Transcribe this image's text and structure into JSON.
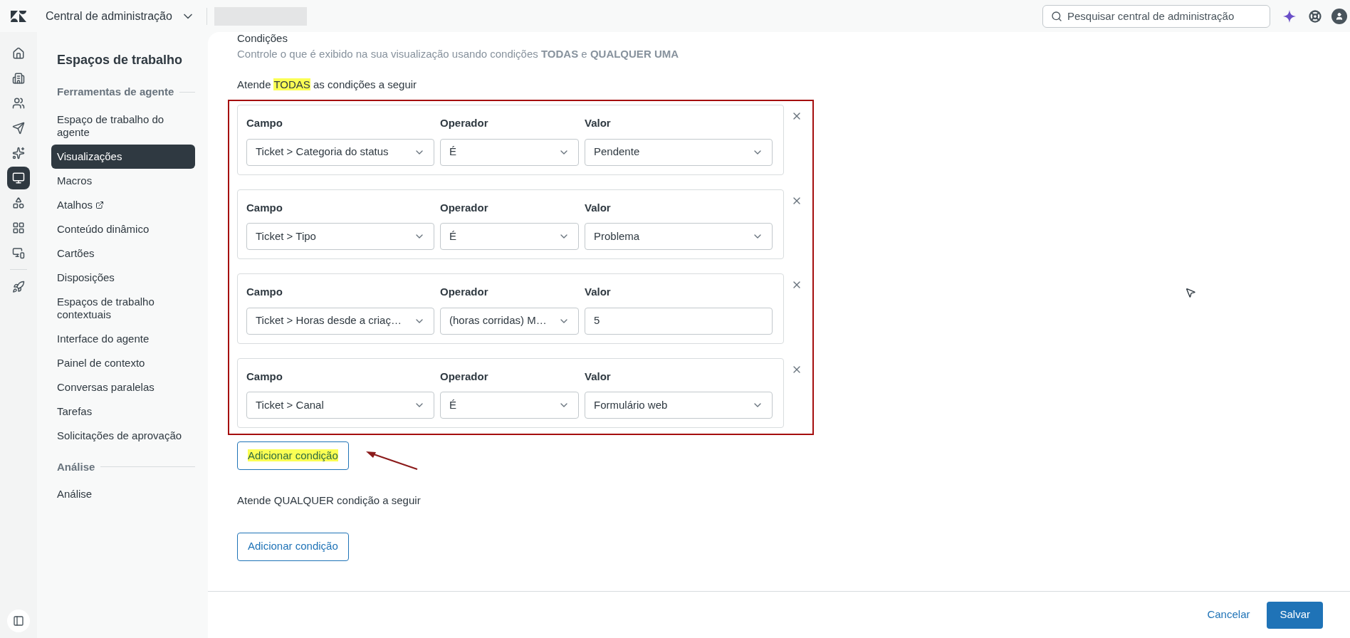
{
  "top_bar": {
    "title": "Central de administração",
    "search": {
      "placeholder": "Pesquisar central de administração"
    }
  },
  "rail": [
    {
      "selected": false
    },
    {
      "selected": false
    },
    {
      "selected": false
    },
    {
      "selected": false
    },
    {
      "selected": false
    },
    {
      "selected": true
    },
    {
      "selected": false
    },
    {
      "selected": false
    },
    {
      "selected": false
    },
    {
      "selected": false
    }
  ],
  "sidebar": {
    "title": "Espaços de trabalho",
    "sections": [
      {
        "heading": "Ferramentas de agente",
        "items": [
          {
            "label": "Espaço de trabalho do agente",
            "selected": false,
            "external": false
          },
          {
            "label": "Visualizações",
            "selected": true,
            "external": false
          },
          {
            "label": "Macros",
            "selected": false,
            "external": false
          },
          {
            "label": "Atalhos",
            "selected": false,
            "external": true
          },
          {
            "label": "Conteúdo dinâmico",
            "selected": false,
            "external": false
          },
          {
            "label": "Cartões",
            "selected": false,
            "external": false
          },
          {
            "label": "Disposições",
            "selected": false,
            "external": false
          },
          {
            "label": "Espaços de trabalho contextuais",
            "selected": false,
            "external": false
          },
          {
            "label": "Interface do agente",
            "selected": false,
            "external": false
          },
          {
            "label": "Painel de contexto",
            "selected": false,
            "external": false
          },
          {
            "label": "Conversas paralelas",
            "selected": false,
            "external": false
          },
          {
            "label": "Tarefas",
            "selected": false,
            "external": false
          },
          {
            "label": "Solicitações de aprovação",
            "selected": false,
            "external": false
          }
        ]
      },
      {
        "heading": "Análise",
        "items": [
          {
            "label": "Análise",
            "selected": false,
            "external": false
          }
        ]
      }
    ]
  },
  "conditions": {
    "heading": "Condições",
    "subtitle": "Controle o que é exibido na sua visualização usando condições **TODAS** e **QUALQUER UMA**",
    "all": {
      "label_before": "Atende ",
      "label_highlight": "TODAS",
      "label_after": " as condições a seguir",
      "rows": [
        {
          "field_label": "Campo",
          "operator_label": "Operador",
          "value_label": "Valor",
          "field": "Ticket > Categoria do status",
          "operator": "É",
          "value": "Pendente",
          "kind": "select"
        },
        {
          "field_label": "Campo",
          "operator_label": "Operador",
          "value_label": "Valor",
          "field": "Ticket > Tipo",
          "operator": "É",
          "value": "Problema",
          "kind": "select"
        },
        {
          "field_label": "Campo",
          "operator_label": "Operador",
          "value_label": "Valor",
          "field": "Ticket > Horas desde a criaç…",
          "operator": "(horas corridas) M…",
          "value": "5",
          "kind": "text"
        },
        {
          "field_label": "Campo",
          "operator_label": "Operador",
          "value_label": "Valor",
          "field": "Ticket > Canal",
          "operator": "É",
          "value": "Formulário web",
          "kind": "select"
        }
      ],
      "add_button": {
        "label": "Adicionar condição",
        "highlighted": true
      }
    },
    "any": {
      "label": "Atende QUALQUER condição a seguir",
      "add_button": {
        "label": "Adicionar condição",
        "highlighted": false
      }
    }
  },
  "footer": {
    "cancel": "Cancelar",
    "save": "Salvar"
  }
}
